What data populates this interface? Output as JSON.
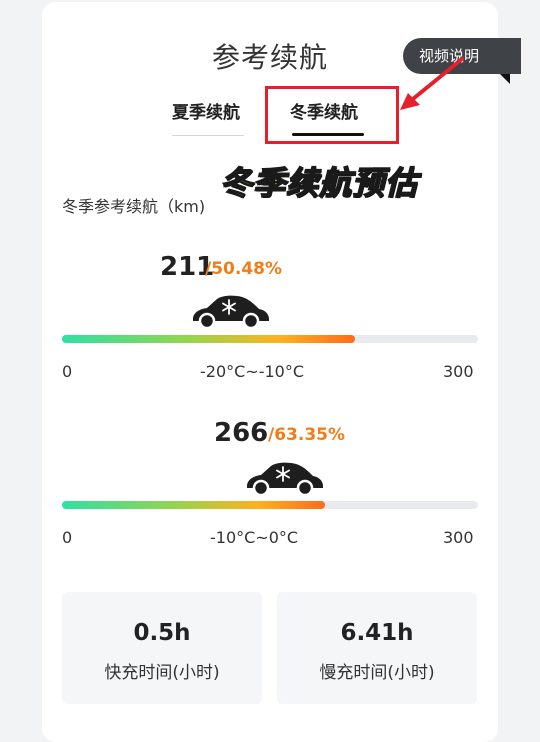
{
  "header": {
    "title": "参考续航",
    "help_button": "视频说明"
  },
  "tabs": [
    {
      "label": "夏季续航",
      "active": false
    },
    {
      "label": "冬季续航",
      "active": true
    }
  ],
  "overlay_caption": "冬季续航预估",
  "section_label": "冬季参考续航（km)",
  "ranges": [
    {
      "value": "211",
      "percent": "/50.48%",
      "min": "0",
      "temp": "-20°C~-10°C",
      "max": "300",
      "fill_fraction": 0.7033
    },
    {
      "value": "266",
      "percent": "/63.35%",
      "min": "0",
      "temp": "-10°C~0°C",
      "max": "300",
      "fill_fraction": 0.6333
    }
  ],
  "stats": [
    {
      "value": "0.5h",
      "label": "快充时间(小时)"
    },
    {
      "value": "6.41h",
      "label": "慢充时间(小时)"
    }
  ],
  "colors": {
    "accent_orange": "#f07d1a",
    "highlight_red": "#e5202a",
    "caption_yellow": "#ffe21a"
  },
  "icons": [
    "car-snowflake-icon",
    "arrow-annotation-icon"
  ]
}
